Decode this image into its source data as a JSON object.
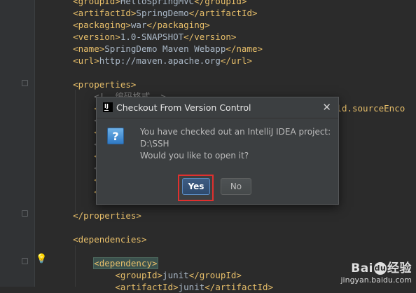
{
  "editor": {
    "lines": [
      {
        "indent": "    ",
        "parts": [
          {
            "c": "tag",
            "t": "<groupId>"
          },
          {
            "c": "txt",
            "t": "HelloSpringMVC"
          },
          {
            "c": "tag",
            "t": "</groupId>"
          }
        ]
      },
      {
        "indent": "    ",
        "parts": [
          {
            "c": "tag",
            "t": "<artifactId>"
          },
          {
            "c": "txt",
            "t": "SpringDemo"
          },
          {
            "c": "tag",
            "t": "</artifactId>"
          }
        ]
      },
      {
        "indent": "    ",
        "parts": [
          {
            "c": "tag",
            "t": "<packaging>"
          },
          {
            "c": "txt",
            "t": "war"
          },
          {
            "c": "tag",
            "t": "</packaging>"
          }
        ]
      },
      {
        "indent": "    ",
        "parts": [
          {
            "c": "tag",
            "t": "<version>"
          },
          {
            "c": "txt",
            "t": "1.0-SNAPSHOT"
          },
          {
            "c": "tag",
            "t": "</version>"
          }
        ]
      },
      {
        "indent": "    ",
        "parts": [
          {
            "c": "tag",
            "t": "<name>"
          },
          {
            "c": "txt",
            "t": "SpringDemo Maven Webapp"
          },
          {
            "c": "tag",
            "t": "</name>"
          }
        ]
      },
      {
        "indent": "    ",
        "parts": [
          {
            "c": "tag",
            "t": "<url>"
          },
          {
            "c": "txt",
            "t": "http://maven.apache.org"
          },
          {
            "c": "tag",
            "t": "</url>"
          }
        ]
      },
      {
        "indent": "",
        "parts": []
      },
      {
        "indent": "    ",
        "parts": [
          {
            "c": "tag",
            "t": "<properties>"
          }
        ]
      },
      {
        "indent": "        ",
        "parts": [
          {
            "c": "cmt",
            "t": "<!--编码格式-->"
          }
        ]
      },
      {
        "indent": "        ",
        "parts": [
          {
            "c": "tag",
            "t": "<pro"
          },
          {
            "c": "txt",
            "t": "                                         "
          },
          {
            "c": "tag",
            "t": "ild.sourceEnco"
          }
        ]
      },
      {
        "indent": "        ",
        "parts": [
          {
            "c": "cmt",
            "t": "<!--"
          }
        ]
      },
      {
        "indent": "        ",
        "parts": [
          {
            "c": "tag",
            "t": "<spr"
          }
        ]
      },
      {
        "indent": "        ",
        "parts": [
          {
            "c": "cmt",
            "t": "<!--"
          }
        ]
      },
      {
        "indent": "        ",
        "parts": [
          {
            "c": "tag",
            "t": "<myb"
          }
        ]
      },
      {
        "indent": "        ",
        "parts": [
          {
            "c": "cmt",
            "t": "<!--"
          }
        ]
      },
      {
        "indent": "        ",
        "parts": [
          {
            "c": "tag",
            "t": "<org"
          },
          {
            "c": "txt",
            "t": "                                     "
          },
          {
            "c": "tag",
            "t": "ion>"
          }
        ]
      },
      {
        "indent": "        ",
        "parts": [
          {
            "c": "tag",
            "t": "<log"
          }
        ]
      },
      {
        "indent": "",
        "parts": []
      },
      {
        "indent": "    ",
        "parts": [
          {
            "c": "tag",
            "t": "</properties>"
          }
        ]
      },
      {
        "indent": "",
        "parts": []
      },
      {
        "indent": "    ",
        "parts": [
          {
            "c": "tag",
            "t": "<dependencies>"
          }
        ]
      },
      {
        "indent": "",
        "parts": []
      },
      {
        "indent": "        ",
        "parts": [
          {
            "c": "tag hl",
            "t": "<dependency>"
          }
        ]
      },
      {
        "indent": "            ",
        "parts": [
          {
            "c": "tag",
            "t": "<groupId>"
          },
          {
            "c": "txt",
            "t": "junit"
          },
          {
            "c": "tag",
            "t": "</groupId>"
          }
        ]
      },
      {
        "indent": "            ",
        "parts": [
          {
            "c": "tag",
            "t": "<artifactId>"
          },
          {
            "c": "txt",
            "t": "junit"
          },
          {
            "c": "tag",
            "t": "</artifactId>"
          }
        ]
      }
    ]
  },
  "dialog": {
    "title": "Checkout From Version Control",
    "logo_text": "IJ",
    "close_glyph": "✕",
    "icon_glyph": "?",
    "message_line1": "You have checked out an IntelliJ IDEA project:",
    "message_line2": "D:\\SSH",
    "message_line3": "Would you like to open it?",
    "yes_label": "Yes",
    "no_label": "No"
  },
  "watermark": {
    "brand_left": "Bai",
    "brand_paw": "du",
    "brand_right": "经验",
    "url": "jingyan.baidu.com"
  },
  "colors": {
    "background": "#2b2b2b",
    "tag": "#e8bf6a",
    "comment": "#808080",
    "highlight_border": "#e0302e"
  }
}
